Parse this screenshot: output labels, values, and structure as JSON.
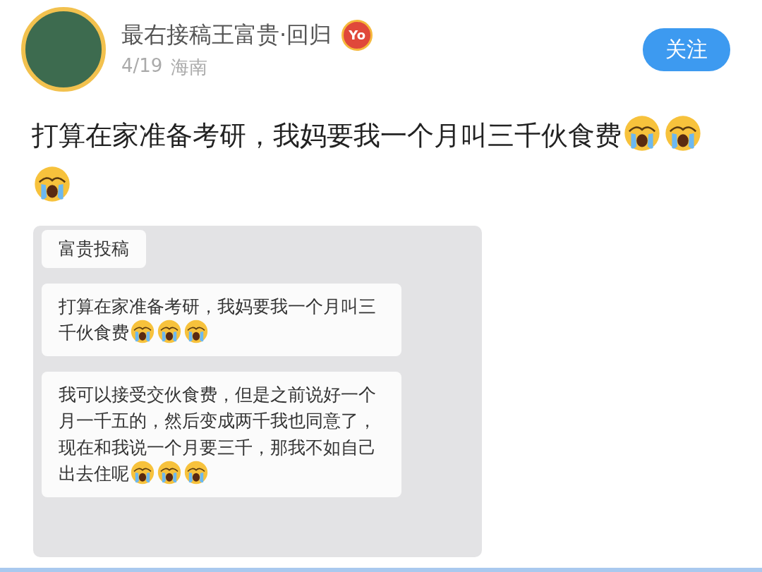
{
  "author": {
    "name": "最右接稿王富贵·回归",
    "badge": "Yo",
    "date": "4/19",
    "location": "海南"
  },
  "follow_button": {
    "label": "关注"
  },
  "post": {
    "parts": [
      {
        "kind": "text",
        "text": "打算在家准备考研，我妈要我一个月叫三千伙食费"
      },
      {
        "kind": "emoji"
      },
      {
        "kind": "emoji"
      },
      {
        "kind": "emoji"
      }
    ]
  },
  "chat_screenshot": {
    "messages": [
      {
        "kind": "title",
        "parts": [
          {
            "kind": "text",
            "text": "富贵投稿"
          }
        ]
      },
      {
        "kind": "message",
        "parts": [
          {
            "kind": "text",
            "text": "打算在家准备考研，我妈要我一个月叫三千伙食费"
          },
          {
            "kind": "emoji"
          },
          {
            "kind": "emoji"
          },
          {
            "kind": "emoji"
          }
        ]
      },
      {
        "kind": "message",
        "parts": [
          {
            "kind": "text",
            "text": "我可以接受交伙食费，但是之前说好一个月一千五的，然后变成两千我也同意了，现在和我说一个月要三千，那我不如自己出去住呢"
          },
          {
            "kind": "emoji"
          },
          {
            "kind": "emoji"
          },
          {
            "kind": "emoji"
          }
        ]
      }
    ]
  }
}
